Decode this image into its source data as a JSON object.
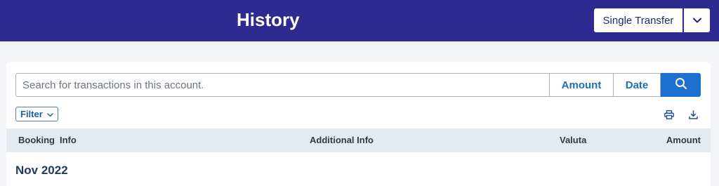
{
  "header": {
    "title": "History",
    "background_color": "#2d2b8f",
    "action_button": {
      "label": "Single Transfer",
      "dropdown_icon": "chevron-down-icon"
    }
  },
  "search": {
    "placeholder": "Search for transactions in this account.",
    "value": "",
    "amount_label": "Amount",
    "date_label": "Date",
    "submit_icon": "search-icon",
    "accent_color": "#1f6fd0"
  },
  "toolbar": {
    "filter_label": "Filter",
    "filter_icon": "chevron-down-icon",
    "print_icon": "print-icon",
    "download_icon": "download-icon"
  },
  "table": {
    "columns": [
      "Booking",
      "Info",
      "Additional Info",
      "Valuta",
      "Amount"
    ]
  },
  "groups": [
    {
      "month": "Nov 2022"
    }
  ]
}
